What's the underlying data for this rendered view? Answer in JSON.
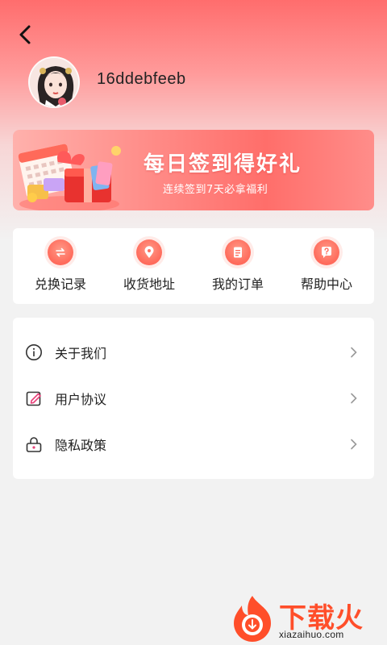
{
  "header": {
    "back_icon": "chevron-left-icon",
    "username": "16ddebfeeb"
  },
  "banner": {
    "title": "每日签到得好礼",
    "subtitle": "连续签到7天必拿福利"
  },
  "quick_actions": [
    {
      "label": "兑换记录",
      "icon": "exchange-icon"
    },
    {
      "label": "收货地址",
      "icon": "location-pin-icon"
    },
    {
      "label": "我的订单",
      "icon": "document-icon"
    },
    {
      "label": "帮助中心",
      "icon": "question-icon"
    }
  ],
  "menu": [
    {
      "label": "关于我们",
      "icon": "info-icon"
    },
    {
      "label": "用户协议",
      "icon": "edit-icon"
    },
    {
      "label": "隐私政策",
      "icon": "lock-icon"
    }
  ],
  "watermark": {
    "title": "下载火",
    "url": "xiazaihuo.com"
  },
  "colors": {
    "accent": "#ff5a4e",
    "header_gradient_top": "#ff6d6d",
    "background": "#f2f2f2"
  }
}
